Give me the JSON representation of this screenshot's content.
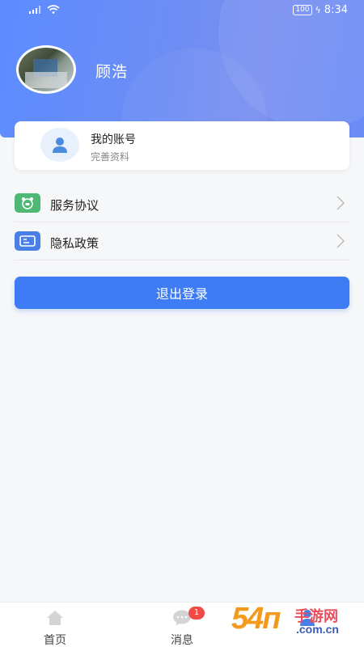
{
  "status_bar": {
    "battery": "100",
    "time": "8:34"
  },
  "profile": {
    "name": "顾浩"
  },
  "account": {
    "title": "我的账号",
    "subtitle": "完善资料"
  },
  "menu": [
    {
      "label": "服务协议",
      "icon": "agreement-icon",
      "color": "#4fb874"
    },
    {
      "label": "隐私政策",
      "icon": "privacy-icon",
      "color": "#4a7fe5"
    }
  ],
  "logout_label": "退出登录",
  "bottom_nav": {
    "home": "首页",
    "messages": "消息",
    "message_badge": "1"
  },
  "watermark": {
    "number": "54п",
    "chinese": "手游网",
    "site": ".com.cn"
  },
  "colors": {
    "primary": "#3d7cf5",
    "header_gradient_start": "#5d8cff",
    "badge": "#f04a45"
  }
}
